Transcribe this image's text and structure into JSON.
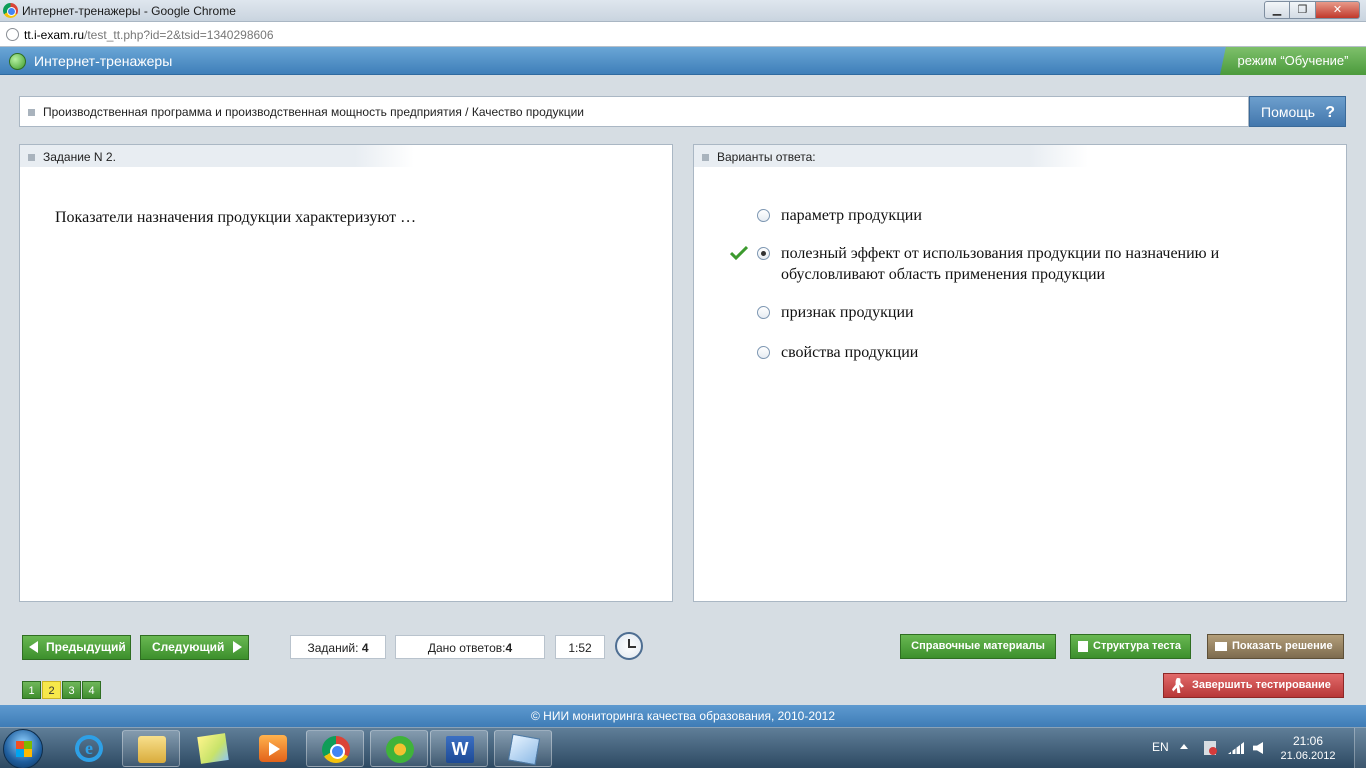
{
  "window": {
    "title": "Интернет-тренажеры - Google Chrome",
    "min_label": "▁",
    "max_label": "❐",
    "close_label": "✕"
  },
  "address": {
    "host": "tt.i-exam.ru",
    "path": "/test_tt.php?id=2&tsid=1340298606"
  },
  "app": {
    "title": "Интернет-тренажеры",
    "mode": "режим “Обучение”"
  },
  "breadcrumb": {
    "text": "Производственная программа и производственная мощность предприятия / Качество продукции"
  },
  "help": {
    "label": "Помощь",
    "icon": "?"
  },
  "task": {
    "header": "Задание N 2.",
    "question": "Показатели назначения продукции характеризуют …"
  },
  "answers": {
    "header": "Варианты ответа:",
    "options": [
      {
        "text": "параметр продукции",
        "selected": false,
        "correct": false
      },
      {
        "text": "полезный эффект от использования продукции по назначению и обусловливают область применения продукции",
        "selected": true,
        "correct": true
      },
      {
        "text": "признак продукции",
        "selected": false,
        "correct": false
      },
      {
        "text": "свойства продукции",
        "selected": false,
        "correct": false
      }
    ]
  },
  "toolbar": {
    "prev_label": "Предыдущий",
    "next_label": "Следующий",
    "tasks_label": "Заданий:",
    "tasks_count": "4",
    "answers_label": "Дано ответов:",
    "answers_count": "4",
    "timer": "1:52",
    "reference_label": "Справочные материалы",
    "structure_label": "Структура теста",
    "solution_label": "Показать решение",
    "finish_label": "Завершить тестирование"
  },
  "pages": [
    {
      "label": "1",
      "current": false
    },
    {
      "label": "2",
      "current": true
    },
    {
      "label": "3",
      "current": false
    },
    {
      "label": "4",
      "current": false
    }
  ],
  "footer": {
    "text": "© НИИ мониторинга качества образования, 2010-2012"
  },
  "taskbar": {
    "lang": "EN",
    "time": "21:06",
    "date": "21.06.2012",
    "word_letter": "W",
    "ie_letter": "e"
  },
  "colors": {
    "header_blue": "#3f7fb9",
    "button_green": "#3c8f2c",
    "finish_red": "#b73737",
    "current_page_yellow": "#f7e84b"
  }
}
